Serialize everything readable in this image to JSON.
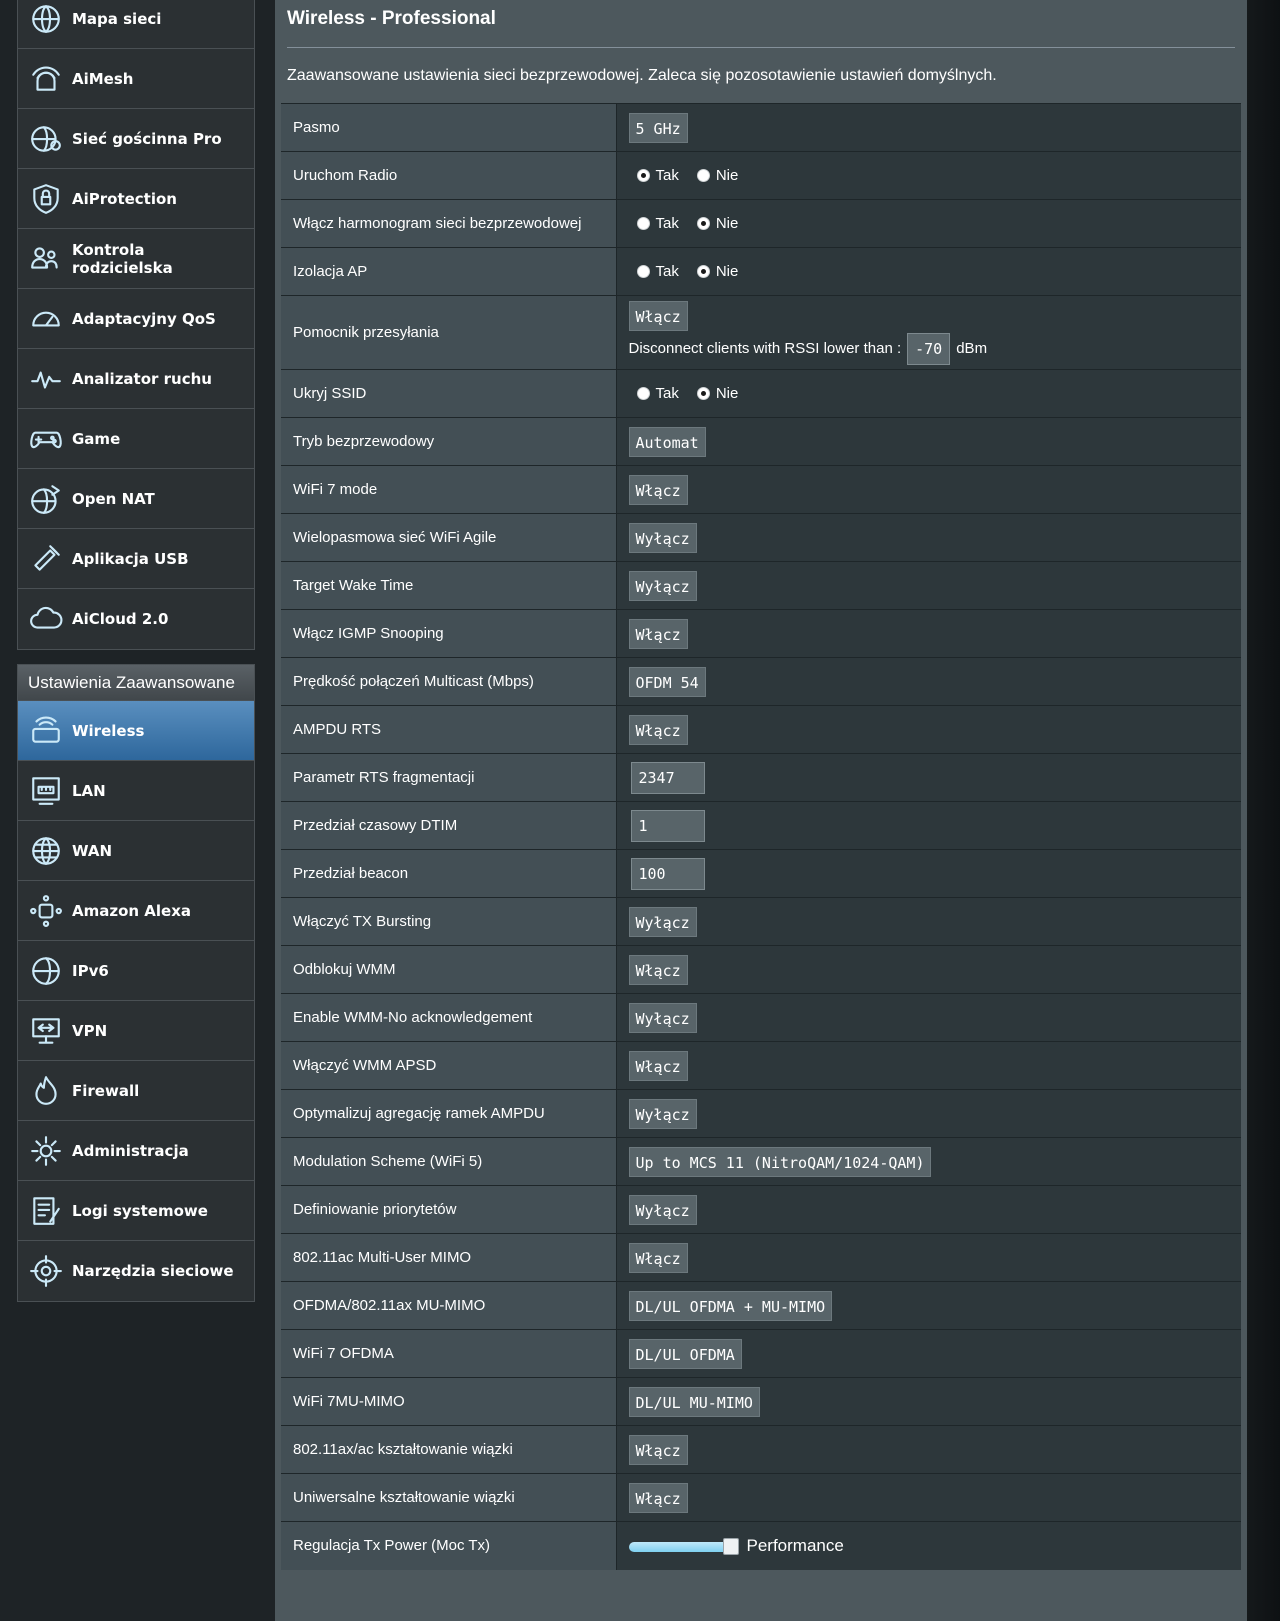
{
  "sidebar": {
    "general_items": [
      {
        "label": "Mapa sieci",
        "icon": "network-map-icon"
      },
      {
        "label": "AiMesh",
        "icon": "aimesh-icon"
      },
      {
        "label": "Sieć gościnna Pro",
        "icon": "guest-network-icon"
      },
      {
        "label": "AiProtection",
        "icon": "shield-lock-icon"
      },
      {
        "label": "Kontrola rodzicielska",
        "icon": "parental-control-icon"
      },
      {
        "label": "Adaptacyjny QoS",
        "icon": "speedometer-icon"
      },
      {
        "label": "Analizator ruchu",
        "icon": "traffic-analyzer-icon"
      },
      {
        "label": "Game",
        "icon": "gamepad-icon"
      },
      {
        "label": "Open NAT",
        "icon": "open-nat-icon"
      },
      {
        "label": "Aplikacja USB",
        "icon": "usb-app-icon"
      },
      {
        "label": "AiCloud 2.0",
        "icon": "cloud-icon"
      }
    ],
    "advanced_title": "Ustawienia Zaawansowane",
    "advanced_items": [
      {
        "label": "Wireless",
        "icon": "wireless-icon",
        "active": true
      },
      {
        "label": "LAN",
        "icon": "lan-icon"
      },
      {
        "label": "WAN",
        "icon": "wan-globe-icon"
      },
      {
        "label": "Amazon Alexa",
        "icon": "alexa-icon"
      },
      {
        "label": "IPv6",
        "icon": "ipv6-icon"
      },
      {
        "label": "VPN",
        "icon": "vpn-icon"
      },
      {
        "label": "Firewall",
        "icon": "firewall-icon"
      },
      {
        "label": "Administracja",
        "icon": "admin-gear-icon"
      },
      {
        "label": "Logi systemowe",
        "icon": "system-log-icon"
      },
      {
        "label": "Narzędzia sieciowe",
        "icon": "network-tools-icon"
      }
    ]
  },
  "main": {
    "title": "Wireless - Professional",
    "description": "Zaawansowane ustawienia sieci bezprzewodowej. Zaleca się pozosotawienie ustawień domyślnych.",
    "rows": [
      {
        "label": "Pasmo",
        "type": "select",
        "value": "5 GHz"
      },
      {
        "label": "Uruchom Radio",
        "type": "radio",
        "options": [
          "Tak",
          "Nie"
        ],
        "selected": 0
      },
      {
        "label": "Włącz harmonogram sieci bezprzewodowej",
        "type": "radio",
        "options": [
          "Tak",
          "Nie"
        ],
        "selected": 1
      },
      {
        "label": "Izolacja AP",
        "type": "radio",
        "options": [
          "Tak",
          "Nie"
        ],
        "selected": 1
      },
      {
        "label": "Pomocnik przesyłania",
        "type": "roaming",
        "value": "Włącz",
        "rssi_label": "Disconnect clients with RSSI lower than :",
        "rssi_value": "-70",
        "rssi_unit": "dBm"
      },
      {
        "label": "Ukryj SSID",
        "type": "radio",
        "options": [
          "Tak",
          "Nie"
        ],
        "selected": 1
      },
      {
        "label": "Tryb bezprzewodowy",
        "type": "select",
        "value": "Automat"
      },
      {
        "label": "WiFi 7 mode",
        "type": "select",
        "value": "Włącz"
      },
      {
        "label": "Wielopasmowa sieć WiFi Agile",
        "type": "select",
        "value": "Wyłącz"
      },
      {
        "label": "Target Wake Time",
        "type": "select",
        "value": "Wyłącz"
      },
      {
        "label": "Włącz IGMP Snooping",
        "type": "select",
        "value": "Włącz"
      },
      {
        "label": "Prędkość połączeń Multicast (Mbps)",
        "type": "select",
        "value": "OFDM 54"
      },
      {
        "label": "AMPDU RTS",
        "type": "select",
        "value": "Włącz"
      },
      {
        "label": "Parametr RTS fragmentacji",
        "type": "input",
        "value": "2347"
      },
      {
        "label": "Przedział czasowy DTIM",
        "type": "input",
        "value": "1"
      },
      {
        "label": "Przedział beacon",
        "type": "input",
        "value": "100"
      },
      {
        "label": "Włączyć TX Bursting",
        "type": "select",
        "value": "Wyłącz"
      },
      {
        "label": "Odblokuj WMM",
        "type": "select",
        "value": "Włącz"
      },
      {
        "label": "Enable WMM-No acknowledgement",
        "type": "select",
        "value": "Wyłącz"
      },
      {
        "label": "Włączyć WMM APSD",
        "type": "select",
        "value": "Włącz"
      },
      {
        "label": "Optymalizuj agregację ramek AMPDU",
        "type": "select",
        "value": "Wyłącz"
      },
      {
        "label": "Modulation Scheme (WiFi 5)",
        "type": "select",
        "value": "Up to MCS 11 (NitroQAM/1024-QAM)"
      },
      {
        "label": "Definiowanie priorytetów",
        "type": "select",
        "value": "Wyłącz"
      },
      {
        "label": "802.11ac Multi-User MIMO",
        "type": "select",
        "value": "Włącz"
      },
      {
        "label": "OFDMA/802.11ax MU-MIMO",
        "type": "select",
        "value": "DL/UL OFDMA + MU-MIMO"
      },
      {
        "label": "WiFi 7 OFDMA",
        "type": "select",
        "value": "DL/UL OFDMA"
      },
      {
        "label": "WiFi 7MU-MIMO",
        "type": "select",
        "value": "DL/UL MU-MIMO"
      },
      {
        "label": "802.11ax/ac kształtowanie wiązki",
        "type": "select",
        "value": "Włącz"
      },
      {
        "label": "Uniwersalne kształtowanie wiązki",
        "type": "select",
        "value": "Włącz"
      },
      {
        "label": "Regulacja Tx Power (Moc Tx)",
        "type": "slider",
        "value_label": "Performance",
        "level": 1.0
      }
    ]
  },
  "colors": {
    "background": "#1e2326",
    "panel": "#4d585d",
    "label_cell": "#434f55",
    "value_cell": "#2d373b",
    "active_menu": "#2e679c",
    "slider": "#7fd0f0"
  }
}
